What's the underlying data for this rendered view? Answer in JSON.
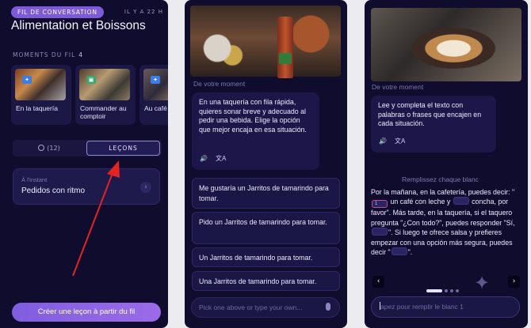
{
  "panel1": {
    "chip": "FIL DE CONVERSATION",
    "ago": "IL Y A 22 H",
    "title": "Alimentation et Boissons",
    "moments_label": "MOMENTS DU FIL",
    "moments_count": "4",
    "moments": [
      {
        "caption": "En la taquería",
        "badge": "✦"
      },
      {
        "caption": "Commander au comptoir",
        "badge": "▣"
      },
      {
        "caption": "Au café",
        "badge": "✦"
      }
    ],
    "toggle": {
      "chat_count": "(12)",
      "lessons_label": "LEÇONS"
    },
    "lesson": {
      "subtitle": "À l'instant",
      "name": "Pedidos con ritmo",
      "chevron": "›"
    },
    "cta": "Créer une leçon à partir du fil"
  },
  "panel2": {
    "source": "De votre moment",
    "prompt": "En una taquería con fila rápida, quieres sonar breve y adecuado al pedir una bebida. Elige la opción que mejor encaja en esa situación.",
    "icons": {
      "speaker": "🔊",
      "translate": "文A"
    },
    "options": [
      "Me gustaría un Jarritos de tamarindo para tomar.",
      "Pido un Jarritos de tamarindo para tomar.",
      "Un Jarritos de tamarindo para tomar.",
      "Una Jarritos de tamarindo para tomar."
    ],
    "input_placeholder": "Pick one above or type your own..."
  },
  "panel3": {
    "source": "De votre moment",
    "prompt": "Lee y completa el texto con palabras o frases que encajen en cada situación.",
    "icons": {
      "speaker": "🔊",
      "translate": "文A"
    },
    "fill_label": "Remplissez chaque blanc",
    "passage": {
      "s1": "Por la mañana, en la cafetería, puedes decir: \"",
      "blank1": "1",
      "s2": " un café con leche y ",
      "s3": " concha, por favor\". Más tarde, en la taquería, si el taquero pregunta \"¿Con todo?\", puedes responder \"Sí, ",
      "s4": "\". Si luego te ofrece salsa y prefieres empezar con una opción más segura, puedes decir \"",
      "s5": "\"."
    },
    "nav": {
      "prev": "‹",
      "next": "›"
    },
    "input_placeholder": "apez pour remplir le blanc 1"
  }
}
